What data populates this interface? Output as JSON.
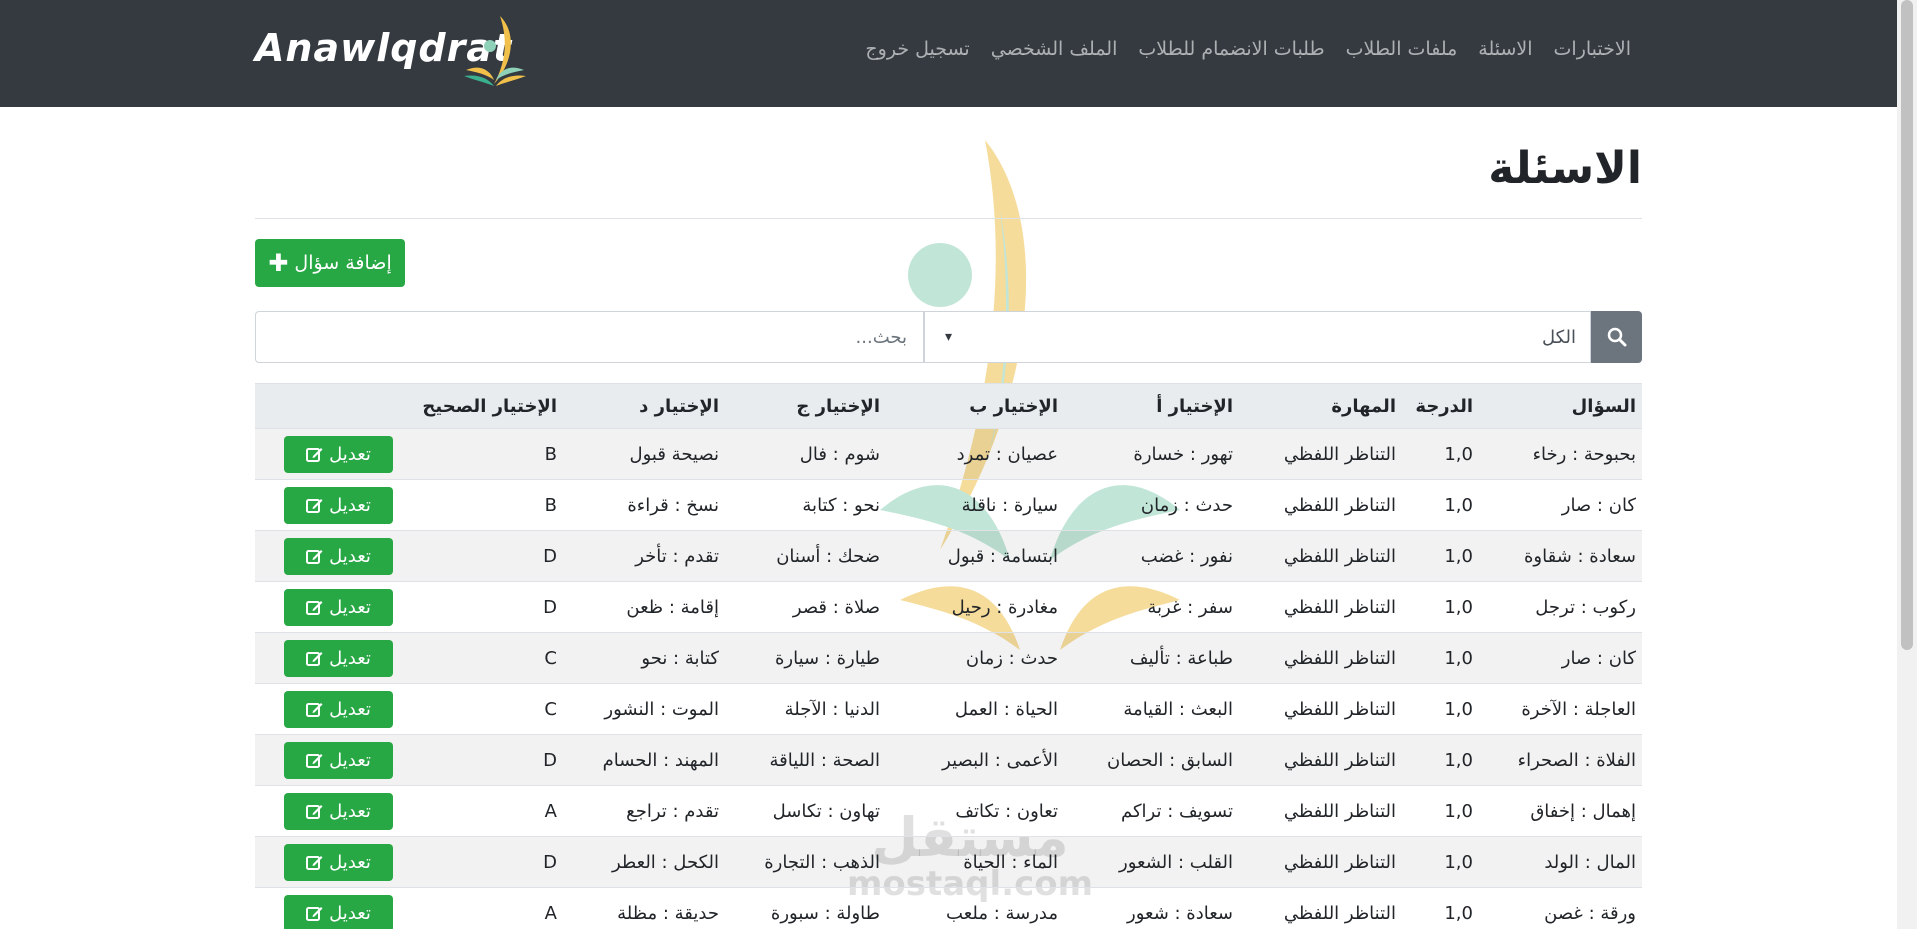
{
  "navbar": {
    "brand": "Anawlqdrat",
    "links": [
      "تسجيل خروج",
      "الملف الشخصي",
      "طلبات الانضمام للطلاب",
      "ملفات الطلاب",
      "الاسئلة",
      "الاختبارات"
    ]
  },
  "page": {
    "title": "الاسئلة",
    "add_button_label": "إضافة سؤال",
    "search_placeholder": "بحث...",
    "filter_selected": "الكل",
    "edit_label": "تعديل"
  },
  "table": {
    "headers": [
      "السؤال",
      "الدرجة",
      "المهارة",
      "الإختيار أ",
      "الإختيار ب",
      "الإختيار ج",
      "الإختيار د",
      "الإختيار الصحيح",
      ""
    ],
    "rows": [
      {
        "question": "بحبوحة : رخاء",
        "degree": "1,0",
        "skill": "التناظر اللفظي",
        "a": "تهور : خسارة",
        "b": "عصيان : تمرد",
        "c": "شوم : فال",
        "d": "نصيحة قبول",
        "correct": "B"
      },
      {
        "question": "كان : صار",
        "degree": "1,0",
        "skill": "التناظر اللفظي",
        "a": "حدث : زمان",
        "b": "سيارة : ناقلة",
        "c": "نحو : كتابة",
        "d": "نسخ : قراءة",
        "correct": "B"
      },
      {
        "question": "سعادة : شقاوة",
        "degree": "1,0",
        "skill": "التناظر اللفظي",
        "a": "نفور : غضب",
        "b": "ابتسامة : قبول",
        "c": "ضحك : أسنان",
        "d": "تقدم : تأخر",
        "correct": "D"
      },
      {
        "question": "ركوب : ترجل",
        "degree": "1,0",
        "skill": "التناظر اللفظي",
        "a": "سفر : غربة",
        "b": "مغادرة : رحيل",
        "c": "صلاة : قصر",
        "d": "إقامة : ظعن",
        "correct": "D"
      },
      {
        "question": "كان : صار",
        "degree": "1,0",
        "skill": "التناظر اللفظي",
        "a": "طباعة : تأليف",
        "b": "حدث : زمان",
        "c": "طيارة : سيارة",
        "d": "كتابة : نحو",
        "correct": "C"
      },
      {
        "question": "العاجلة : الآخرة",
        "degree": "1,0",
        "skill": "التناظر اللفظي",
        "a": "البعث : القيامة",
        "b": "الحياة : العمل",
        "c": "الدنيا : الآجلة",
        "d": "الموت : النشور",
        "correct": "C"
      },
      {
        "question": "الفلاة : الصحراء",
        "degree": "1,0",
        "skill": "التناظر اللفظي",
        "a": "السابق : الحصان",
        "b": "الأعمى : البصير",
        "c": "الصحة : اللياقة",
        "d": "المهند : الحسام",
        "correct": "D"
      },
      {
        "question": "إهمال : إخفاق",
        "degree": "1,0",
        "skill": "التناظر اللفظي",
        "a": "تسويف : تراكم",
        "b": "تعاون : تكاتف",
        "c": "تهاون : تكاسل",
        "d": "تقدم : تراجع",
        "correct": "A"
      },
      {
        "question": "المال : الولد",
        "degree": "1,0",
        "skill": "التناظر اللفظي",
        "a": "القلب : الشعور",
        "b": "الماء : الحياة",
        "c": "الذهب : التجارة",
        "d": "الكحل : العطر",
        "correct": "D"
      },
      {
        "question": "ورقة : غصن",
        "degree": "1,0",
        "skill": "التناظر اللفظي",
        "a": "سعادة : شعور",
        "b": "مدرسة : ملعب",
        "c": "طاولة : سبورة",
        "d": "حديقة : مظلة",
        "correct": "A"
      }
    ]
  },
  "watermark": {
    "arabic": "مستقل",
    "latin": "mostaql.com"
  },
  "icons": {
    "add": "plus-icon",
    "search": "search-icon",
    "edit": "edit-icon",
    "dropdown": "chevron-down-icon"
  },
  "colors": {
    "navbar": "#343a40",
    "success": "#28a745",
    "secondary": "#6c757d"
  }
}
